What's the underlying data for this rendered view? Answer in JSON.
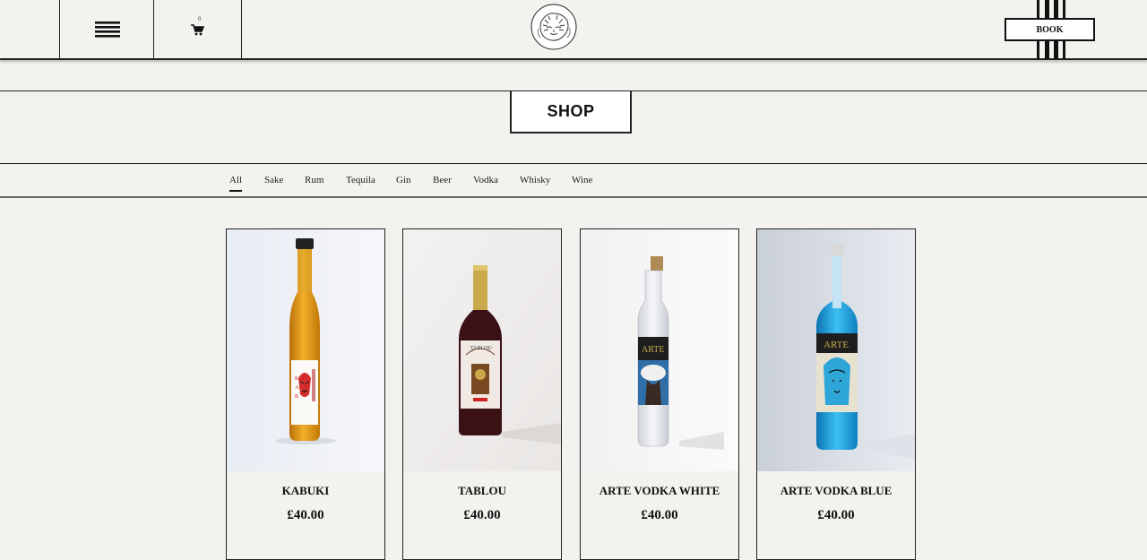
{
  "header": {
    "cart_count": "0",
    "book_label": "BOOK"
  },
  "shop": {
    "title": "SHOP"
  },
  "filters": [
    "All",
    "Sake",
    "Rum",
    "Tequila",
    "Gin",
    "Beer",
    "Vodka",
    "Whisky",
    "Wine"
  ],
  "active_filter": "All",
  "products": [
    {
      "name": "KABUKI",
      "price": "£40.00"
    },
    {
      "name": "TABLOU",
      "price": "£40.00"
    },
    {
      "name": "ARTE VODKA WHITE",
      "price": "£40.00"
    },
    {
      "name": "ARTE VODKA BLUE",
      "price": "£40.00"
    }
  ],
  "colors": {
    "background": "#f3f2ee",
    "border": "#222222",
    "sake_liquid": "#e49a1c",
    "wine_bottle": "#3a1216",
    "vodka_blue": "#1aa2e0"
  }
}
